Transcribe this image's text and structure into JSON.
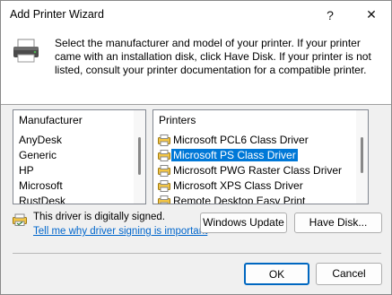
{
  "window": {
    "title": "Add Printer Wizard",
    "help_label": "?",
    "close_label": "✕"
  },
  "header": {
    "icon": "printer-icon",
    "text": "Select the manufacturer and model of your printer. If your printer came with an installation disk, click Have Disk. If your printer is not listed, consult your printer documentation for a compatible printer."
  },
  "manufacturer_list": {
    "header": "Manufacturer",
    "items": [
      "AnyDesk",
      "Generic",
      "HP",
      "Microsoft",
      "RustDesk"
    ],
    "selected": "Microsoft"
  },
  "printers_list": {
    "header": "Printers",
    "items": [
      "Microsoft PCL6 Class Driver",
      "Microsoft PS Class Driver",
      "Microsoft PWG Raster Class Driver",
      "Microsoft XPS Class Driver",
      "Remote Desktop Easy Print"
    ],
    "selected": "Microsoft PS Class Driver",
    "item_icon": "printer-driver-icon"
  },
  "signature": {
    "icon": "signed-driver-icon",
    "text": "This driver is digitally signed.",
    "link": "Tell me why driver signing is important"
  },
  "buttons": {
    "windows_update": "Windows Update",
    "have_disk": "Have Disk...",
    "ok": "OK",
    "cancel": "Cancel"
  },
  "colors": {
    "selection": "#0078d7",
    "link": "#0066cc",
    "accent_border": "#0067c0"
  }
}
